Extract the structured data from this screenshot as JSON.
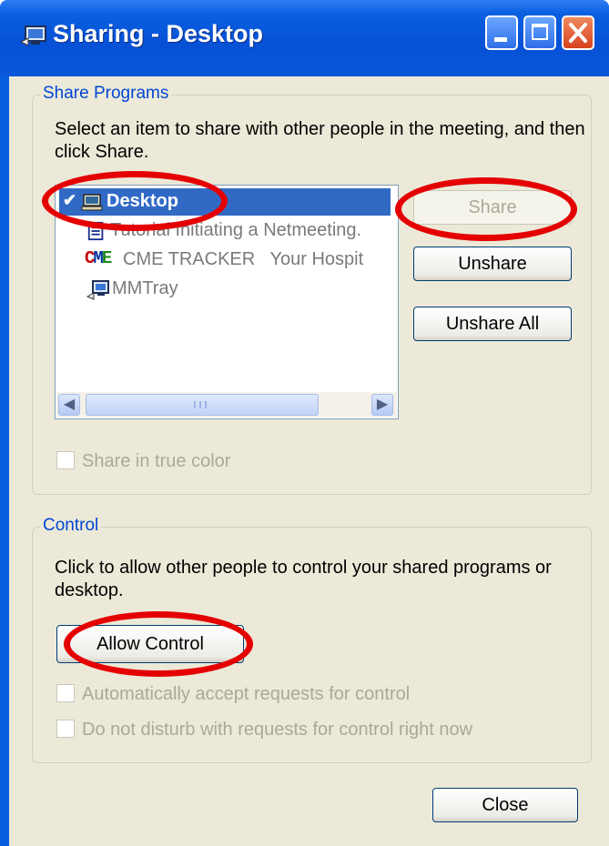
{
  "window": {
    "title": "Sharing - Desktop"
  },
  "share_programs": {
    "group_label": "Share Programs",
    "description": "Select an item to share with other people in the meeting, and then click Share.",
    "items": [
      {
        "label": "Desktop",
        "selected": true,
        "checked": true,
        "icon": "desktop-icon"
      },
      {
        "label": "Tutorial Initiating a Netmeeting.",
        "selected": false,
        "icon": "document-icon"
      },
      {
        "label": "CME TRACKER   Your Hospit",
        "selected": false,
        "icon": "cme-icon"
      },
      {
        "label": "MMTray",
        "selected": false,
        "icon": "computer-icon"
      }
    ],
    "buttons": {
      "share": "Share",
      "unshare": "Unshare",
      "unshare_all": "Unshare All"
    },
    "true_color_label": "Share in true color"
  },
  "control": {
    "group_label": "Control",
    "description": "Click to allow other people to control your shared programs or desktop.",
    "allow_control": "Allow Control",
    "auto_accept_label": "Automatically accept requests for control",
    "do_not_disturb_label": "Do not disturb with requests for control right now"
  },
  "footer": {
    "close": "Close"
  },
  "colors": {
    "titlebar": "#0a5fe0",
    "selection": "#316ac5",
    "group_label": "#0046d5",
    "highlight_ring": "#e40000"
  }
}
